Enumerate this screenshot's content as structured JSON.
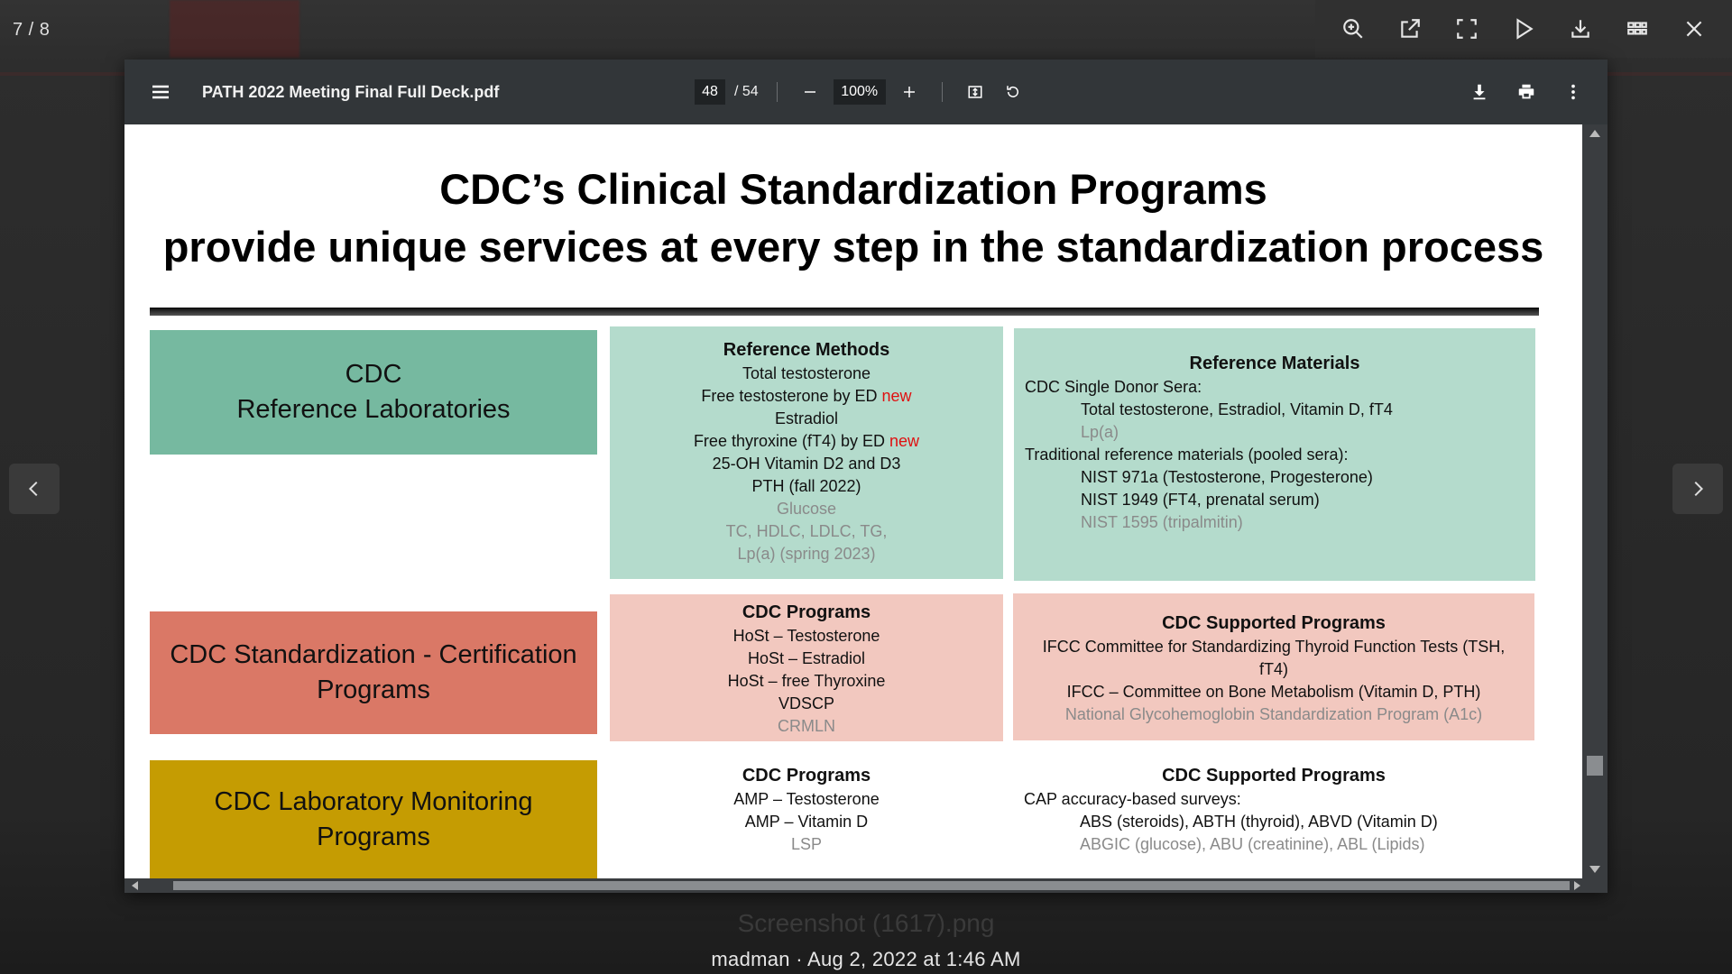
{
  "viewer": {
    "counter": "7 / 8",
    "caption": "madman · Aug 2, 2022 at 1:46 AM",
    "caption_ghost": "Screenshot (1617).png"
  },
  "pdf": {
    "filename": "PATH 2022 Meeting Final Full Deck.pdf",
    "current_page": "48",
    "total_pages": "/ 54",
    "zoom": "100%"
  },
  "slide": {
    "title_line1": "CDC’s Clinical Standardization Programs",
    "title_line2": "provide unique services at every step in the standardization process",
    "categories": {
      "ref_line1": "CDC",
      "ref_line2": "Reference Laboratories",
      "cert": "CDC Standardization - Certification Programs",
      "mon": "CDC Laboratory Monitoring Programs"
    },
    "methods": {
      "heading": "Reference Methods",
      "l1": "Total testosterone",
      "l2": "Free testosterone by ED",
      "l2_new": "new",
      "l3": "Estradiol",
      "l4": "Free thyroxine (fT4) by ED",
      "l4_new": "new",
      "l5": "25-OH Vitamin D2 and D3",
      "l6": "PTH (fall 2022)",
      "l7": "Glucose",
      "l8": "TC, HDLC, LDLC, TG,",
      "l9": "Lp(a) (spring 2023)"
    },
    "materials": {
      "heading": "Reference Materials",
      "l1": "CDC Single Donor Sera:",
      "l2": "Total testosterone, Estradiol, Vitamin D, fT4",
      "l3": "Lp(a)",
      "l4": "Traditional reference materials (pooled sera):",
      "l5": "NIST 971a (Testosterone, Progesterone)",
      "l6": "NIST 1949 (FT4, prenatal serum)",
      "l7": "NIST 1595 (tripalmitin)"
    },
    "cert_programs": {
      "heading": "CDC Programs",
      "l1": "HoSt – Testosterone",
      "l2": "HoSt – Estradiol",
      "l3": "HoSt – free Thyroxine",
      "l4": "VDSCP",
      "l5": "CRMLN"
    },
    "cert_supported": {
      "heading": "CDC Supported Programs",
      "l1": "IFCC Committee for Standardizing Thyroid Function Tests (TSH,",
      "l2": "fT4)",
      "l3": "IFCC – Committee on Bone Metabolism (Vitamin D, PTH)",
      "l4": "National Glycohemoglobin Standardization Program (A1c)"
    },
    "mon_programs": {
      "heading": "CDC Programs",
      "l1": "AMP – Testosterone",
      "l2": "AMP – Vitamin D",
      "l3": "LSP"
    },
    "mon_supported": {
      "heading": "CDC Supported Programs",
      "l1": "CAP accuracy-based surveys:",
      "l2": "ABS (steroids), ABTH (thyroid), ABVD (Vitamin D)",
      "l3": "ABGIC (glucose), ABU (creatinine), ABL (Lipids)"
    }
  },
  "colors": {
    "ref_category": "#76b9a0",
    "cert_category": "#da7866",
    "mon_category": "#c59c02",
    "teal_panel": "#b4dbcc",
    "pink_panel": "#f2c8bf",
    "new_label": "#e01010"
  }
}
